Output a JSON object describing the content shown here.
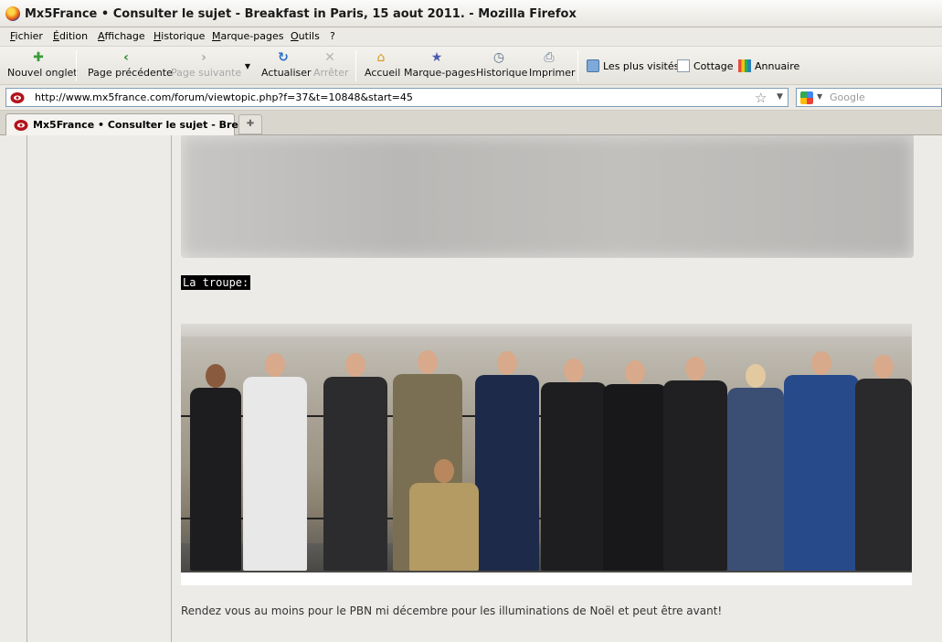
{
  "window": {
    "title": "Mx5France • Consulter le sujet - Breakfast in Paris, 15 aout 2011. - Mozilla Firefox"
  },
  "menu": [
    "Fichier",
    "Édition",
    "Affichage",
    "Historique",
    "Marque-pages",
    "Outils",
    "?"
  ],
  "toolbar": {
    "new_tab": "Nouvel onglet",
    "back": "Page précédente",
    "forward": "Page suivante",
    "reload": "Actualiser",
    "stop": "Arrêter",
    "home": "Accueil",
    "bookmarks": "Marque-pages",
    "history": "Historique",
    "print": "Imprimer"
  },
  "bookmarks_bar": [
    "Les plus visités",
    "Cottage",
    "Annuaire"
  ],
  "navbar": {
    "url": "http://www.mx5france.com/forum/viewtopic.php?f=37&t=10848&start=45",
    "search_placeholder": "Google"
  },
  "tabs": [
    {
      "label": "Mx5France • Consulter le sujet - Bre..."
    }
  ],
  "post": {
    "caption": "La troupe:",
    "text": "Rendez vous au moins pour le PBN mi décembre pour les illuminations de Noël et peut être avant!"
  },
  "colors": {
    "caption_bg": "#000000",
    "content_bg": "#ecebe8"
  }
}
